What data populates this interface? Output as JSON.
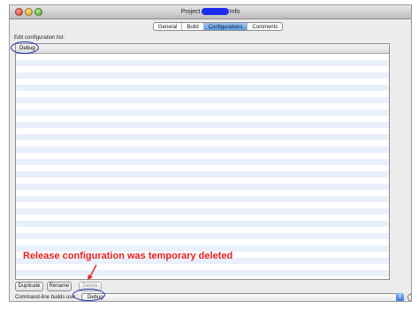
{
  "window": {
    "title_prefix": "Project",
    "title_suffix": "Info"
  },
  "tabs": [
    {
      "label": "General"
    },
    {
      "label": "Build"
    },
    {
      "label": "Configurations",
      "active": true
    },
    {
      "label": "Comments"
    }
  ],
  "config": {
    "section_label": "Edit configuration list:",
    "column_header": "Debug"
  },
  "buttons": {
    "duplicate": "Duplicate",
    "rename": "Rename",
    "delete": "Delete"
  },
  "command_line": {
    "label": "Command-line builds use:",
    "value": "Debug"
  },
  "help_icon": "?",
  "annotation": "Release configuration was temporary deleted",
  "colors": {
    "annotation": "#e32020",
    "highlight_ellipse": "#1f2fb8",
    "title_redaction": "#1c2df0",
    "selected_tab": "#5d9be3"
  }
}
